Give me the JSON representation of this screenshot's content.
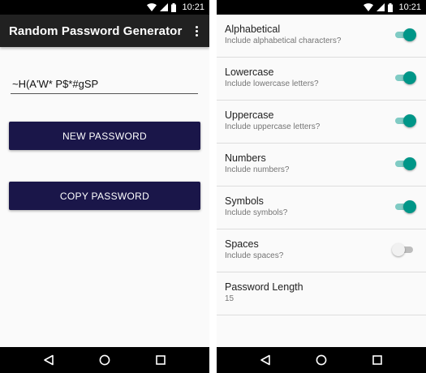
{
  "status": {
    "time": "10:21"
  },
  "main_screen": {
    "app_title": "Random Password Generator",
    "password_value": "~H(A'W* P$*#gSP",
    "new_password_button": "NEW PASSWORD",
    "copy_password_button": "COPY PASSWORD"
  },
  "settings": {
    "items": [
      {
        "title": "Alphabetical",
        "subtitle": "Include alphabetical characters?",
        "enabled": true
      },
      {
        "title": "Lowercase",
        "subtitle": "Include lowercase letters?",
        "enabled": true
      },
      {
        "title": "Uppercase",
        "subtitle": "Include uppercase letters?",
        "enabled": true
      },
      {
        "title": "Numbers",
        "subtitle": "Include numbers?",
        "enabled": true
      },
      {
        "title": "Symbols",
        "subtitle": "Include symbols?",
        "enabled": true
      },
      {
        "title": "Spaces",
        "subtitle": "Include spaces?",
        "enabled": false
      }
    ],
    "password_length": {
      "title": "Password Length",
      "value": "15"
    }
  },
  "colors": {
    "app_bar": "#212121",
    "button": "#1a1649",
    "toggle_on": "#009688",
    "toggle_track_on": "#80cbc4"
  },
  "icons": {
    "status": [
      "wifi-icon",
      "cell-signal-icon",
      "battery-icon"
    ],
    "nav": [
      "back-icon",
      "home-icon",
      "recents-icon"
    ],
    "app_bar": "overflow-menu-icon"
  }
}
